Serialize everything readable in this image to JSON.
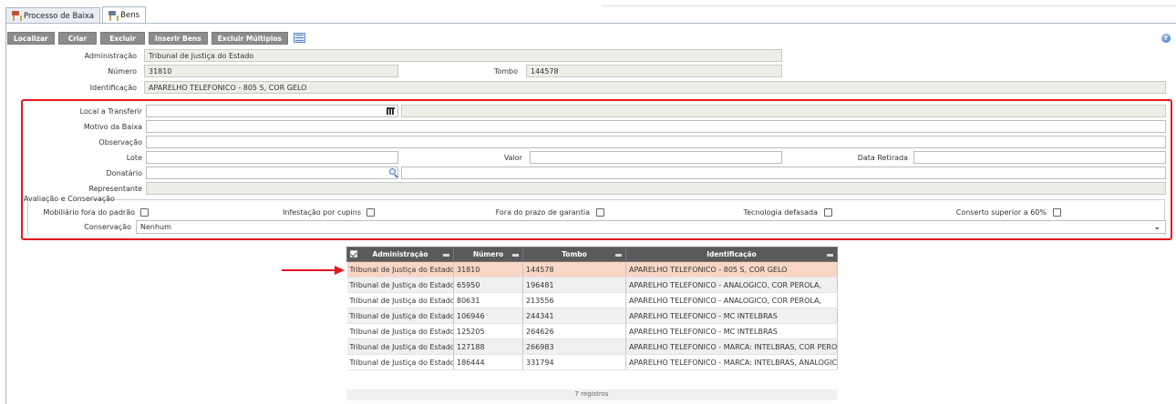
{
  "tabs": [
    {
      "label": "Processo de Baixa",
      "icon": "document-icon"
    },
    {
      "label": "Bens",
      "icon": "document-icon"
    }
  ],
  "toolbar": {
    "localizar": "Localizar",
    "criar": "Criar",
    "excluir": "Excluir",
    "inserir_bens": "Inserir Bens",
    "excluir_multiplos": "Excluir Múltiplos",
    "help": "?"
  },
  "info": {
    "administracao_label": "Administração",
    "administracao_value": "Tribunal de Justiça do Estado",
    "numero_label": "Número",
    "numero_value": "31810",
    "tombo_label": "Tombo",
    "tombo_value": "144578",
    "identificacao_label": "Identificação",
    "identificacao_value": "APARELHO TELEFONICO - 805 S, COR GELO"
  },
  "form": {
    "local_label": "Local a Transferir",
    "local_value": "",
    "motivo_label": "Motivo da Baixa",
    "motivo_value": "",
    "observacao_label": "Observação",
    "observacao_value": "",
    "lote_label": "Lote",
    "lote_value": "",
    "valor_label": "Valor",
    "valor_value": "",
    "data_retirada_label": "Data Retirada",
    "data_retirada_value": "",
    "donatario_label": "Donatário",
    "donatario_value": "",
    "representante_label": "Representante",
    "representante_value": ""
  },
  "avaliacao": {
    "legend": "Avaliação e Conservação",
    "mobiliario": "Mobiliário fora do padrão",
    "infestacao": "Infestação por cupins",
    "fora_prazo": "Fora do prazo de garantia",
    "tecnologia": "Tecnologia defasada",
    "conserto": "Conserto superior a 60%",
    "conservacao_label": "Conservação",
    "conservacao_value": "Nenhum"
  },
  "table": {
    "columns": [
      "Administração",
      "Número",
      "Tombo",
      "Identificação"
    ],
    "rows": [
      [
        "Tribunal de Justiça do Estado",
        "31810",
        "144578",
        "APARELHO TELEFONICO - 805 S, COR GELO"
      ],
      [
        "Tribunal de Justiça do Estado",
        "65950",
        "196481",
        "APARELHO TELEFONICO - ANALOGICO, COR PEROLA,"
      ],
      [
        "Tribunal de Justiça do Estado",
        "80631",
        "213556",
        "APARELHO TELEFONICO - ANALOGICO, COR PEROLA,"
      ],
      [
        "Tribunal de Justiça do Estado",
        "106946",
        "244341",
        "APARELHO TELEFONICO - MC INTELBRAS"
      ],
      [
        "Tribunal de Justiça do Estado",
        "125205",
        "264626",
        "APARELHO TELEFONICO - MC INTELBRAS"
      ],
      [
        "Tribunal de Justiça do Estado",
        "127188",
        "266983",
        "APARELHO TELEFONICO - MARCA: INTELBRAS, COR PEROLA"
      ],
      [
        "Tribunal de Justiça do Estado",
        "186444",
        "331794",
        "APARELHO TELEFONICO - MARCA: INTELBRAS, ANALOGICO"
      ]
    ],
    "footer": "7 registros"
  },
  "colors": {
    "highlight_border": "#e3151f",
    "selected_row": "#f9d6c6",
    "header_bg": "#5a5a5a",
    "button_bg": "#8c8c8c"
  }
}
